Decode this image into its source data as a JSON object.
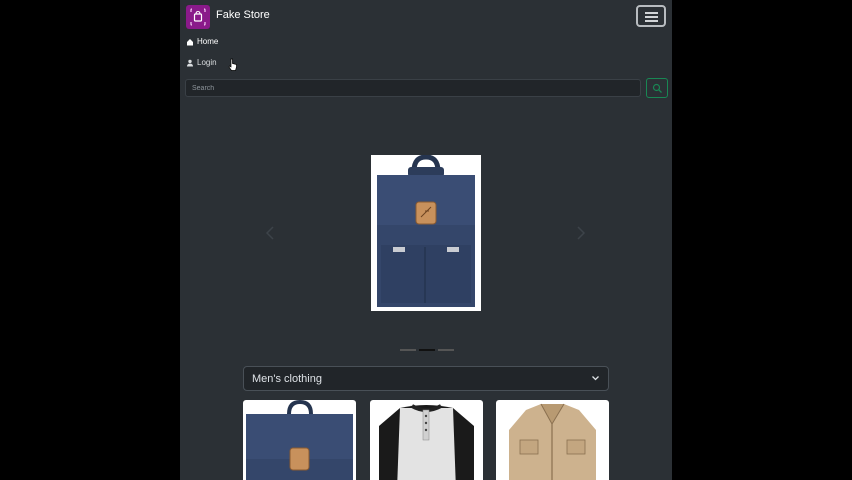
{
  "navbar": {
    "brand_name": "Fake Store",
    "logo_icon": "shopping-bag-icon",
    "toggler_icon": "hamburger-menu-icon"
  },
  "nav": {
    "items": [
      {
        "label": "Home",
        "icon": "home-icon"
      },
      {
        "label": "Login",
        "icon": "user-icon"
      }
    ]
  },
  "search": {
    "placeholder": "Search",
    "button_icon": "search-icon"
  },
  "carousel": {
    "slide_image": "blue-backpack",
    "slide_count": 3,
    "active_slide": 2
  },
  "category": {
    "selected": "Men's clothing"
  },
  "products": [
    {
      "image": "blue-backpack"
    },
    {
      "image": "raglan-henley-shirt"
    },
    {
      "image": "khaki-jacket"
    }
  ],
  "colors": {
    "app_bg": "#2b3035",
    "brand_logo": "#8a1a8a",
    "search_button_border": "#198754"
  }
}
